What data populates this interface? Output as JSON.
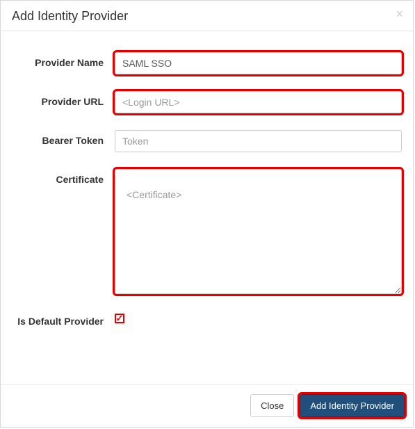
{
  "modal": {
    "title": "Add Identity Provider",
    "close_glyph": "×"
  },
  "form": {
    "provider_name": {
      "label": "Provider Name",
      "value": "SAML SSO"
    },
    "provider_url": {
      "label": "Provider URL",
      "placeholder": "<Login URL>",
      "value": ""
    },
    "bearer_token": {
      "label": "Bearer Token",
      "placeholder": "Token",
      "value": ""
    },
    "certificate": {
      "label": "Certificate",
      "placeholder": "<Certificate>",
      "value": ""
    },
    "is_default": {
      "label": "Is Default Provider",
      "checked": true,
      "check_glyph": "✓"
    }
  },
  "footer": {
    "close_label": "Close",
    "submit_label": "Add Identity Provider"
  }
}
